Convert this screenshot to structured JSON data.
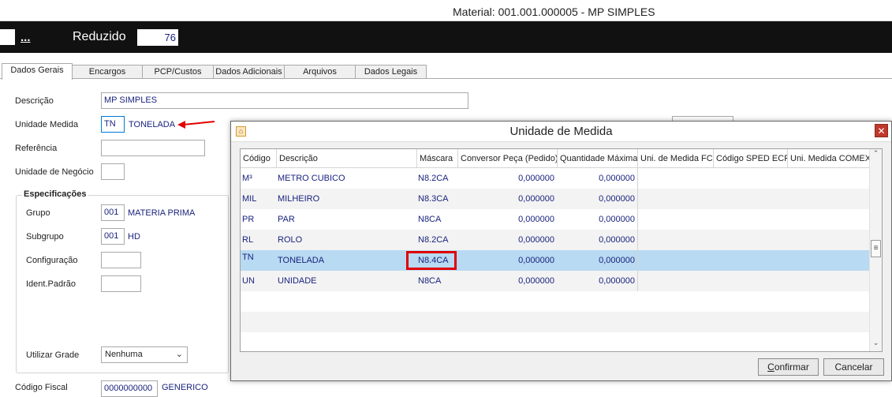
{
  "window": {
    "title": "Material: 001.001.000005 - MP SIMPLES"
  },
  "header": {
    "dots": "...",
    "reduzido_label": "Reduzido",
    "reduzido_value": "76"
  },
  "tabs": [
    "Dados Gerais",
    "Encargos",
    "PCP/Custos",
    "Dados Adicionais",
    "Arquivos",
    "Dados Legais"
  ],
  "form": {
    "descricao_label": "Descrição",
    "descricao_value": "MP SIMPLES",
    "unidade_label": "Unidade Medida",
    "unidade_code": "TN",
    "unidade_desc": "TONELADA",
    "referencia_label": "Referência",
    "unidade_negocio_label": "Unidade de Negócio",
    "especificacoes_title": "Especificações",
    "grupo_label": "Grupo",
    "grupo_code": "001",
    "grupo_desc": "MATERIA PRIMA",
    "subgrupo_label": "Subgrupo",
    "subgrupo_code": "001",
    "subgrupo_desc": "HD",
    "configuracao_label": "Configuração",
    "ident_label": "Ident.Padrão",
    "grade_label": "Utilizar Grade",
    "grade_value": "Nenhuma",
    "fiscal_label": "Código Fiscal",
    "fiscal_value": "0000000000",
    "fiscal_desc": "GENERICO"
  },
  "dialog": {
    "title": "Unidade de Medida",
    "columns": [
      "Código",
      "Descrição",
      "Máscara",
      "Conversor Peça (Pedido)",
      "Quantidade Máxima",
      "Uni. de Medida FCI",
      "Código SPED ECF",
      "Uni. Medida COMEX"
    ],
    "rows": [
      {
        "codigo": "M³",
        "descricao": "METRO CUBICO",
        "mascara": "N8.2CA",
        "conversor": "0,000000",
        "qtd": "0,000000"
      },
      {
        "codigo": "MIL",
        "descricao": "MILHEIRO",
        "mascara": "N8.3CA",
        "conversor": "0,000000",
        "qtd": "0,000000"
      },
      {
        "codigo": "PR",
        "descricao": "PAR",
        "mascara": "N8CA",
        "conversor": "0,000000",
        "qtd": "0,000000"
      },
      {
        "codigo": "RL",
        "descricao": "ROLO",
        "mascara": "N8.2CA",
        "conversor": "0,000000",
        "qtd": "0,000000"
      },
      {
        "codigo": "TN",
        "descricao": "TONELADA",
        "mascara": "N8.4CA",
        "conversor": "0,000000",
        "qtd": "0,000000"
      },
      {
        "codigo": "UN",
        "descricao": "UNIDADE",
        "mascara": "N8CA",
        "conversor": "0,000000",
        "qtd": "0,000000"
      }
    ],
    "selected_row": 4,
    "confirm_label": "onfirmar",
    "confirm_accel": "C",
    "cancel_label": "Cancelar"
  },
  "colors": {
    "selected_row": "#b8daf2",
    "highlight_border": "#e00000",
    "value_text": "#1a237e"
  }
}
